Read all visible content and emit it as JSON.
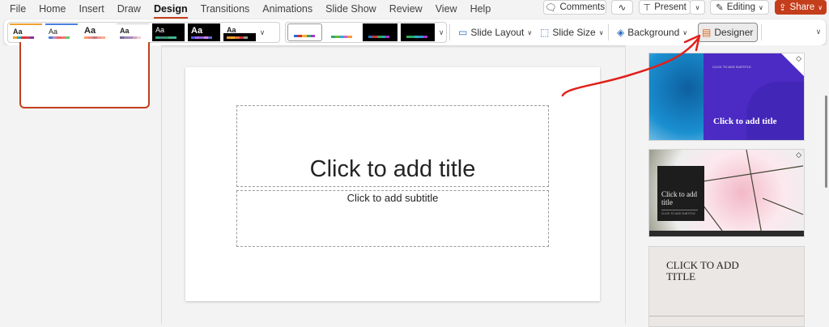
{
  "menu": {
    "tabs": [
      "File",
      "Home",
      "Insert",
      "Draw",
      "Design",
      "Transitions",
      "Animations",
      "Slide Show",
      "Review",
      "View",
      "Help"
    ],
    "active": "Design"
  },
  "top_buttons": {
    "comments": "Comments",
    "present": "Present",
    "editing": "Editing",
    "share": "Share"
  },
  "ribbon": {
    "themes_label": "Aa",
    "slide_layout": "Slide Layout",
    "slide_size": "Slide Size",
    "background": "Background",
    "designer": "Designer"
  },
  "slide": {
    "title_placeholder": "Click to add title",
    "subtitle_placeholder": "Click to add subtitle"
  },
  "designer_pane": {
    "ideas": [
      {
        "title": "Click to add title",
        "subtitle": "CLICK TO ADD SUBTITLE",
        "premium": true
      },
      {
        "title": "Click to add title",
        "subtitle": "CLICK TO ADD SUBTITLE",
        "premium": true
      },
      {
        "title": "CLICK TO ADD TITLE",
        "premium": false
      }
    ]
  },
  "colors": {
    "accent": "#c43e1c",
    "share": "#c43e1c",
    "annotation_arrow": "#e0201b",
    "idea1_purple": "#4b2bc4"
  }
}
